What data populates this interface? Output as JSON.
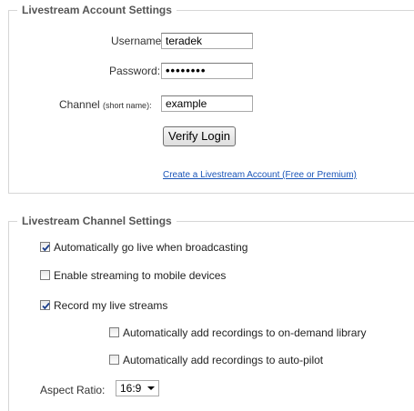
{
  "account": {
    "legend": "Livestream Account Settings",
    "username_label": "Username:",
    "username_value": "teradek",
    "password_label": "Password:",
    "password_value": "••••••••",
    "channel_label": "Channel",
    "channel_hint": "(short name):",
    "channel_value": "example",
    "verify_label": "Verify Login",
    "create_link": "Create a Livestream Account (Free or Premium)"
  },
  "channel": {
    "legend": "Livestream Channel Settings",
    "options": [
      {
        "label": "Automatically go live when broadcasting",
        "checked": true
      },
      {
        "label": "Enable streaming to mobile devices",
        "checked": false
      },
      {
        "label": "Record my live streams",
        "checked": true
      },
      {
        "label": "Automatically add recordings to on-demand library",
        "checked": false
      },
      {
        "label": "Automatically add recordings to auto-pilot",
        "checked": false
      }
    ],
    "aspect_label": "Aspect Ratio:",
    "aspect_value": "16:9"
  }
}
